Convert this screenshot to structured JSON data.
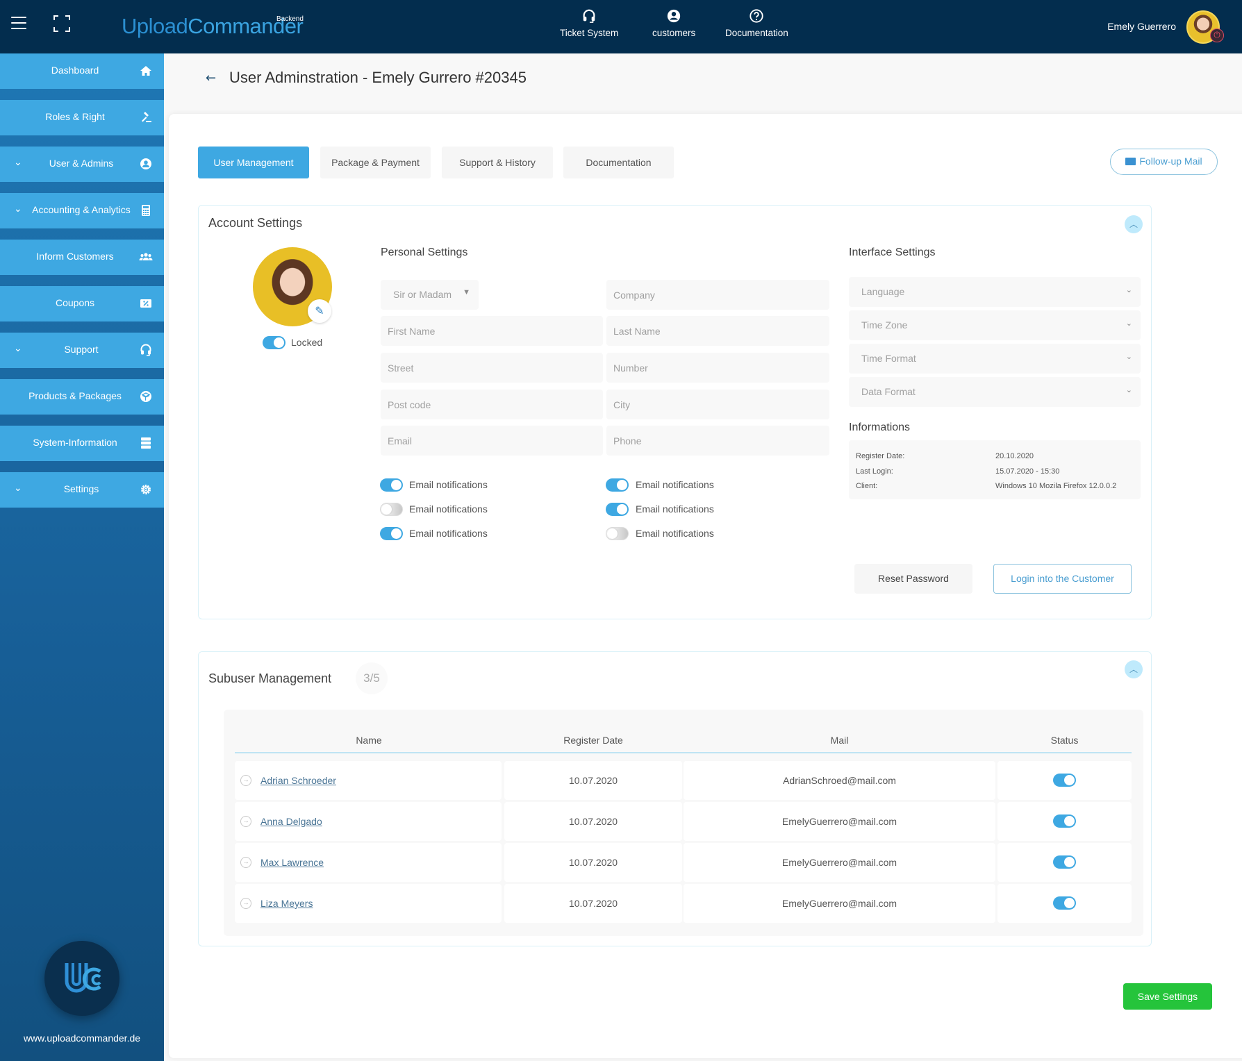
{
  "topbar": {
    "logo_part1": "Upload",
    "logo_part2": "Commander",
    "logo_sup": "Backend",
    "nav": [
      {
        "label": "Ticket System",
        "icon": "headset-icon"
      },
      {
        "label": "customers",
        "icon": "user-circle-icon"
      },
      {
        "label": "Documentation",
        "icon": "question-circle-icon"
      }
    ],
    "user_name": "Emely Guerrero"
  },
  "sidebar": {
    "items": [
      {
        "label": "Dashboard",
        "icon": "home-icon",
        "expandable": false
      },
      {
        "label": "Roles & Right",
        "icon": "gavel-icon",
        "expandable": false
      },
      {
        "label": "User & Admins",
        "icon": "user-circle-icon",
        "expandable": true
      },
      {
        "label": "Accounting & Analytics",
        "icon": "calculator-icon",
        "expandable": true
      },
      {
        "label": "Inform Customers",
        "icon": "users-icon",
        "expandable": false
      },
      {
        "label": "Coupons",
        "icon": "coupon-icon",
        "expandable": false
      },
      {
        "label": "Support",
        "icon": "headset-icon",
        "expandable": true
      },
      {
        "label": "Products & Packages",
        "icon": "box-icon",
        "expandable": false
      },
      {
        "label": "System-Information",
        "icon": "server-icon",
        "expandable": false
      },
      {
        "label": "Settings",
        "icon": "gear-icon",
        "expandable": true
      }
    ],
    "logo_text": "UC",
    "site_url": "www.uploadcommander.de"
  },
  "page": {
    "back_icon": "←",
    "title": "User Adminstration - Emely Gurrero #20345"
  },
  "tabs": [
    {
      "label": "User Management",
      "active": true
    },
    {
      "label": "Package & Payment",
      "active": false
    },
    {
      "label": "Support & History",
      "active": false
    },
    {
      "label": "Documentation",
      "active": false
    }
  ],
  "follow_up_mail": "Follow-up Mail",
  "account_settings": {
    "title": "Account Settings",
    "locked_label": "Locked",
    "locked": true,
    "personal_title": "Personal Settings",
    "salutation": "Sir or Madam",
    "fields": {
      "company": "Company",
      "first_name": "First Name",
      "last_name": "Last Name",
      "street": "Street",
      "number": "Number",
      "post_code": "Post code",
      "city": "City",
      "email": "Email",
      "phone": "Phone"
    },
    "notifications": [
      {
        "label": "Email notifications",
        "on": true
      },
      {
        "label": "Email notifications",
        "on": false
      },
      {
        "label": "Email notifications",
        "on": true
      },
      {
        "label": "Email notifications",
        "on": true
      },
      {
        "label": "Email notifications",
        "on": true
      },
      {
        "label": "Email notifications",
        "on": false
      }
    ],
    "interface_title": "Interface Settings",
    "interface_selects": [
      "Language",
      "Time Zone",
      "Time Format",
      "Data Format"
    ],
    "informations_title": "Informations",
    "informations": [
      {
        "key": "Register Date:",
        "value": "20.10.2020"
      },
      {
        "key": "Last Login:",
        "value": "15.07.2020 - 15:30"
      },
      {
        "key": "Client:",
        "value": "Windows 10 Mozila Firefox 12.0.0.2"
      }
    ],
    "reset_password": "Reset Password",
    "login_customer": "Login into the Customer"
  },
  "subusers": {
    "title": "Subuser Management",
    "count": "3/5",
    "columns": [
      "Name",
      "Register Date",
      "Mail",
      "Status"
    ],
    "rows": [
      {
        "name": "Adrian Schroeder",
        "date": "10.07.2020",
        "mail": "AdrianSchroed@mail.com",
        "active": true
      },
      {
        "name": "Anna Delgado",
        "date": "10.07.2020",
        "mail": "EmelyGuerrero@mail.com",
        "active": true
      },
      {
        "name": "Max Lawrence",
        "date": "10.07.2020",
        "mail": "EmelyGuerrero@mail.com",
        "active": true
      },
      {
        "name": "Liza Meyers",
        "date": "10.07.2020",
        "mail": "EmelyGuerrero@mail.com",
        "active": true
      }
    ]
  },
  "save_settings": "Save Settings",
  "colors": {
    "topbar": "#032d4e",
    "sidebar_item": "#3ea8e2",
    "accent": "#3ea8e2",
    "save": "#25c43b"
  }
}
